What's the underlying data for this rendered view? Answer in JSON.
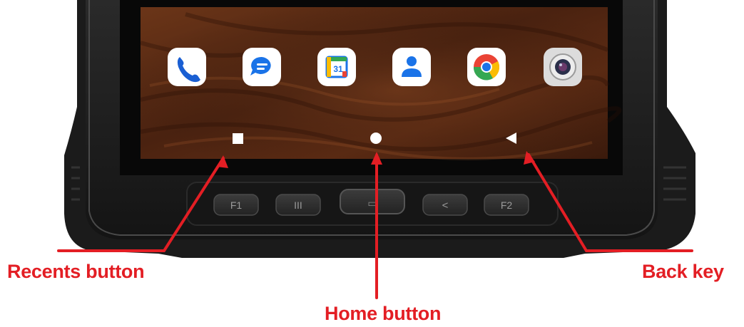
{
  "callouts": {
    "recents": "Recents button",
    "home": "Home button",
    "back": "Back key"
  },
  "hardware_keys": [
    "F1",
    "III",
    "▭",
    "<",
    "F2"
  ],
  "home_screen": {
    "dock_apps": [
      "phone-icon",
      "messages-icon",
      "calendar-icon",
      "contacts-icon",
      "chrome-icon",
      "camera-icon"
    ],
    "calendar_date": "31",
    "nav_buttons": [
      "recents-button",
      "home-button",
      "back-button"
    ]
  },
  "colors": {
    "callout_red": "#e31e24",
    "device_body": "#1e1e1e",
    "wallpaper": "#5a2a14"
  }
}
